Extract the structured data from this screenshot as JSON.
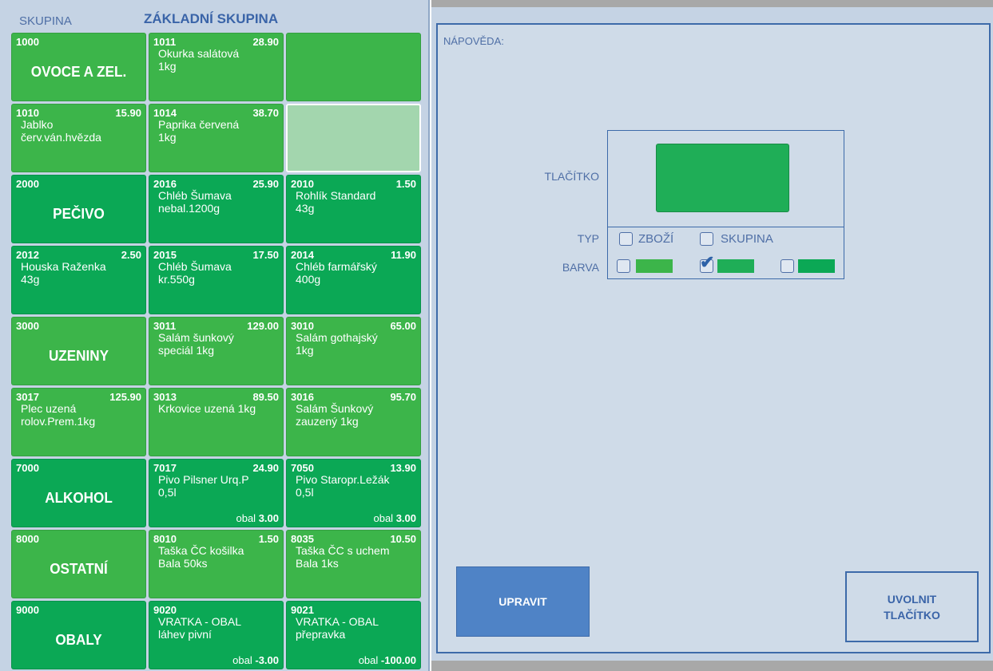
{
  "group": {
    "label": "SKUPINA",
    "name": "ZÁKLADNÍ SKUPINA"
  },
  "help": {
    "label": "NÁPOVĚDA:"
  },
  "preview": {
    "button_label": "TLAČÍTKO",
    "type_label": "TYP",
    "type_option_goods": "ZBOŽÍ",
    "type_option_group": "SKUPINA",
    "color_label": "BARVA",
    "selected_color_index": 1
  },
  "actions": {
    "edit": "UPRAVIT",
    "release_line1": "UVOLNIT",
    "release_line2": "TLAČÍTKO"
  },
  "colors": {
    "light": "#3cb54a",
    "mid": "#1fae57",
    "dark": "#0ba855",
    "pale": "#a3d6ae"
  },
  "buttons": [
    {
      "kind": "group",
      "code": "1000",
      "name": "OVOCE A ZEL.",
      "color": "light"
    },
    {
      "kind": "item",
      "code": "1011",
      "price": "28.90",
      "line1": "Okurka salátová",
      "line2": "1kg",
      "color": "light"
    },
    {
      "kind": "empty",
      "color": "light"
    },
    {
      "kind": "item",
      "code": "1010",
      "price": "15.90",
      "line1": "Jablko",
      "line2": "červ.ván.hvězda",
      "color": "light"
    },
    {
      "kind": "item",
      "code": "1014",
      "price": "38.70",
      "line1": "Paprika červená",
      "line2": "1kg",
      "color": "light"
    },
    {
      "kind": "empty",
      "color": "pale"
    },
    {
      "kind": "group",
      "code": "2000",
      "name": "PEČIVO",
      "color": "dark"
    },
    {
      "kind": "item",
      "code": "2016",
      "price": "25.90",
      "line1": "Chléb Šumava",
      "line2": "nebal.1200g",
      "color": "dark"
    },
    {
      "kind": "item",
      "code": "2010",
      "price": "1.50",
      "line1": "Rohlík Standard",
      "line2": "43g",
      "color": "dark"
    },
    {
      "kind": "item",
      "code": "2012",
      "price": "2.50",
      "line1": "Houska Raženka",
      "line2": "43g",
      "color": "dark"
    },
    {
      "kind": "item",
      "code": "2015",
      "price": "17.50",
      "line1": "Chléb Šumava",
      "line2": "kr.550g",
      "color": "dark"
    },
    {
      "kind": "item",
      "code": "2014",
      "price": "11.90",
      "line1": "Chléb farmářský",
      "line2": "400g",
      "color": "dark"
    },
    {
      "kind": "group",
      "code": "3000",
      "name": "UZENINY",
      "color": "light"
    },
    {
      "kind": "item",
      "code": "3011",
      "price": "129.00",
      "line1": "Salám šunkový",
      "line2": "speciál 1kg",
      "color": "light"
    },
    {
      "kind": "item",
      "code": "3010",
      "price": "65.00",
      "line1": "Salám gothajský",
      "line2": "1kg",
      "color": "light"
    },
    {
      "kind": "item",
      "code": "3017",
      "price": "125.90",
      "line1": "Plec uzená",
      "line2": "rolov.Prem.1kg",
      "color": "light"
    },
    {
      "kind": "item",
      "code": "3013",
      "price": "89.50",
      "line1": "Krkovice uzená 1kg",
      "line2": "",
      "color": "light"
    },
    {
      "kind": "item",
      "code": "3016",
      "price": "95.70",
      "line1": "Salám Šunkový",
      "line2": "zauzený 1kg",
      "color": "light"
    },
    {
      "kind": "group",
      "code": "7000",
      "name": "ALKOHOL",
      "color": "dark"
    },
    {
      "kind": "item",
      "code": "7017",
      "price": "24.90",
      "line1": "Pivo Pilsner Urq.P",
      "line2": "0,5l",
      "obal_label": "obal",
      "obal_value": "3.00",
      "color": "dark"
    },
    {
      "kind": "item",
      "code": "7050",
      "price": "13.90",
      "line1": "Pivo Staropr.Ležák",
      "line2": "0,5l",
      "obal_label": "obal",
      "obal_value": "3.00",
      "color": "dark"
    },
    {
      "kind": "group",
      "code": "8000",
      "name": "OSTATNÍ",
      "color": "light"
    },
    {
      "kind": "item",
      "code": "8010",
      "price": "1.50",
      "line1": "Taška ČC košilka",
      "line2": "Bala 50ks",
      "color": "light"
    },
    {
      "kind": "item",
      "code": "8035",
      "price": "10.50",
      "line1": "Taška ČC s uchem",
      "line2": "Bala 1ks",
      "color": "light"
    },
    {
      "kind": "group",
      "code": "9000",
      "name": "OBALY",
      "color": "dark"
    },
    {
      "kind": "item",
      "code": "9020",
      "price": "",
      "line1": "VRATKA - OBAL",
      "line2": "láhev pivní",
      "obal_label": "obal",
      "obal_value": "-3.00",
      "color": "dark"
    },
    {
      "kind": "item",
      "code": "9021",
      "price": "",
      "line1": "VRATKA - OBAL",
      "line2": "přepravka",
      "obal_label": "obal",
      "obal_value": "-100.00",
      "color": "dark"
    }
  ]
}
